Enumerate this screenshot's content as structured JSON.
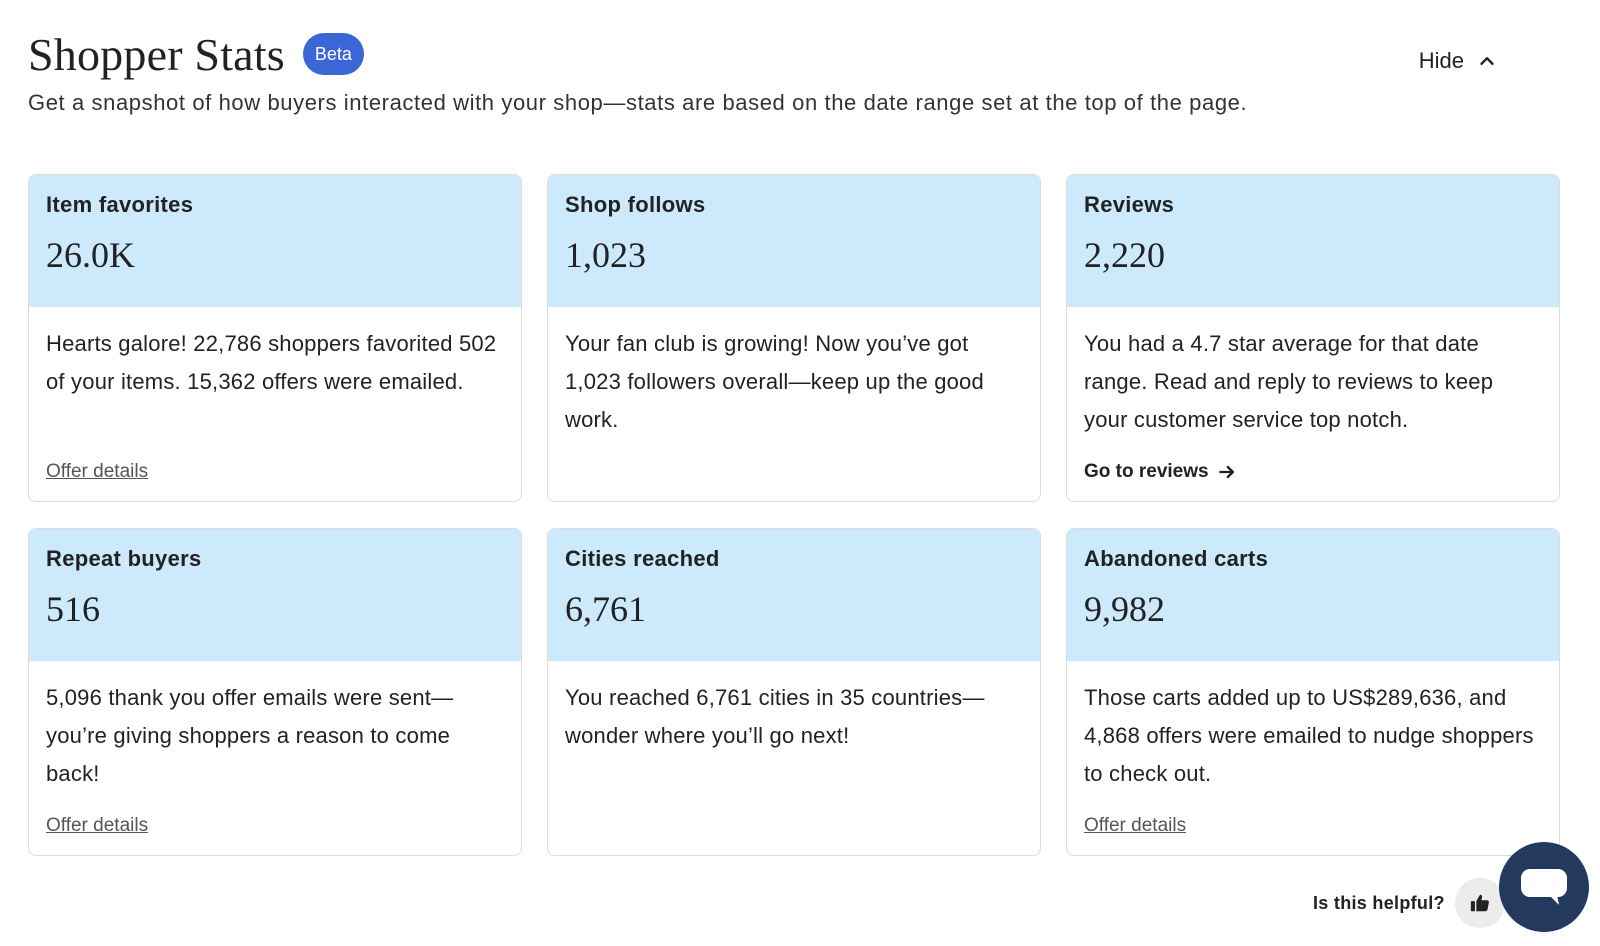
{
  "header": {
    "title": "Shopper Stats",
    "badge": "Beta",
    "subtitle": "Get a snapshot of how buyers interacted with your shop—stats are based on the date range set at the top of the page.",
    "hide_label": "Hide",
    "hide_icon": "chevron-up-icon"
  },
  "cards": [
    {
      "label": "Item favorites",
      "value": "26.0K",
      "description": "Hearts galore! 22,786 shoppers favorited 502 of your items. 15,362 offers were emailed.",
      "link": "Offer details"
    },
    {
      "label": "Shop follows",
      "value": "1,023",
      "description": "Your fan club is growing! Now you’ve got 1,023 followers overall—keep up the good work."
    },
    {
      "label": "Reviews",
      "value": "2,220",
      "description": "You had a 4.7 star average for that date range. Read and reply to reviews to keep your customer service top notch.",
      "link": "Go to reviews",
      "link_icon": "arrow-right-icon"
    },
    {
      "label": "Repeat buyers",
      "value": "516",
      "description": "5,096 thank you offer emails were sent—you’re giving shoppers a reason to come back!",
      "link": "Offer details"
    },
    {
      "label": "Cities reached",
      "value": "6,761",
      "description": "You reached 6,761 cities in 35 countries—wonder where you’ll go next!"
    },
    {
      "label": "Abandoned carts",
      "value": "9,982",
      "description": "Those carts added up to US$289,636, and 4,868 offers were emailed to nudge shoppers to check out.",
      "link": "Offer details"
    }
  ],
  "feedback": {
    "question": "Is this helpful?",
    "icon": "thumbs-up-icon"
  },
  "chat": {
    "icon": "chat-bubble-icon"
  },
  "colors": {
    "accent": "#3b67d6",
    "card_header_bg": "#cdeafc",
    "chat_bg": "#233a5e"
  }
}
